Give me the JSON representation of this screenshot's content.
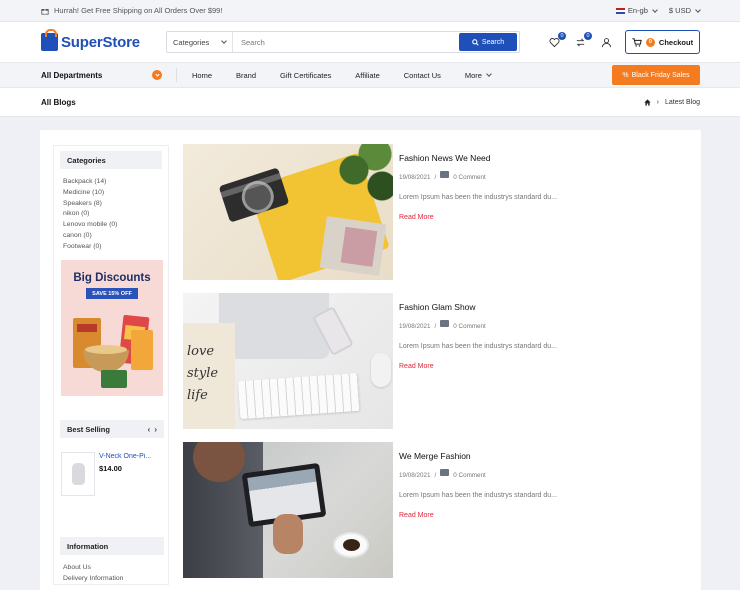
{
  "topbar": {
    "promo_text": "Hurrah! Get Free Shipping on All Orders Over $99!",
    "language": "En-gb",
    "currency": "$ USD"
  },
  "header": {
    "logo": "SuperStore",
    "search_category": "Categories",
    "search_placeholder": "Search",
    "search_button": "Search",
    "wishlist_count": "0",
    "compare_count": "0",
    "cart_count": "0",
    "checkout_label": "Checkout"
  },
  "nav": {
    "departments": "All Departments",
    "links": [
      "Home",
      "Brand",
      "Gift Certificates",
      "Affiliate",
      "Contact Us",
      "More"
    ],
    "promo_button": "Black Friday Sales"
  },
  "breadcrumb": {
    "page_title": "All Blogs",
    "current": "Latest Blog"
  },
  "sidebar": {
    "categories_title": "Categories",
    "categories": [
      "Backpack (14)",
      "Medicine (10)",
      "Speakers (8)",
      "nikon (0)",
      "Lenovo mobile (0)",
      "canon (0)",
      "Footwear (0)"
    ],
    "banner_title": "Big Discounts",
    "banner_badge": "SAVE 15% OFF",
    "best_selling_title": "Best Selling",
    "product_name": "V-Neck One-Pi...",
    "product_price": "$14.00",
    "information_title": "Information",
    "information_links": [
      "About Us",
      "Delivery Information"
    ]
  },
  "posts": [
    {
      "title": "Fashion News We Need",
      "date": "19/08/2021",
      "comments": "0 Comment",
      "excerpt": "Lorem Ipsum has been the industrys standard du...",
      "read_more": "Read More"
    },
    {
      "title": "Fashion Glam Show",
      "date": "19/08/2021",
      "comments": "0 Comment",
      "excerpt": "Lorem Ipsum has been the industrys standard du...",
      "read_more": "Read More"
    },
    {
      "title": "We Merge Fashion",
      "date": "19/08/2021",
      "comments": "0 Comment",
      "excerpt": "Lorem Ipsum has been the industrys standard du...",
      "read_more": "Read More"
    }
  ],
  "colors": {
    "brand_blue": "#1f4fb8",
    "accent_orange": "#f47b20",
    "read_more_red": "#e0273a"
  }
}
